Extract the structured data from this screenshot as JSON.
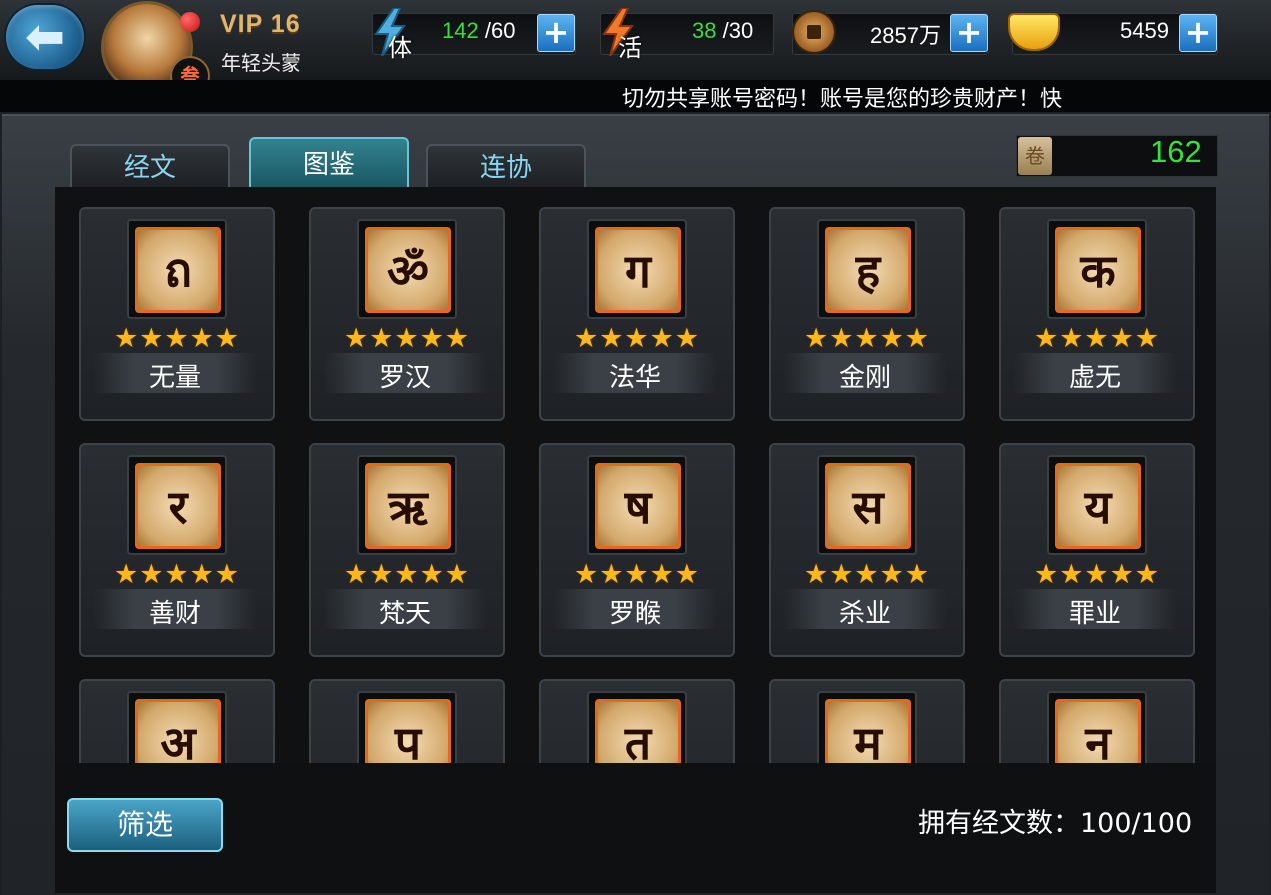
{
  "header": {
    "vip_label": "VIP 16",
    "player_title": "年轻头蒙",
    "rank_badge": "叁",
    "stamina": {
      "icon_label": "体",
      "current": "142",
      "max": "/60"
    },
    "vitality": {
      "icon_label": "活",
      "current": "38",
      "max": "/30"
    },
    "copper": {
      "value": "2857万"
    },
    "gold": {
      "value": "5459"
    },
    "plus_symbol": "+"
  },
  "ticker": {
    "text": "切勿共享账号密码！账号是您的珍贵财产！快"
  },
  "tabs": [
    {
      "label": "经文",
      "active": false
    },
    {
      "label": "图鉴",
      "active": true
    },
    {
      "label": "连协",
      "active": false
    }
  ],
  "counter": {
    "value": "162",
    "icon": "scroll-icon"
  },
  "stars": "★★★★★",
  "cards": [
    {
      "name": "无量",
      "glyph": "ถ"
    },
    {
      "name": "罗汉",
      "glyph": "ॐ"
    },
    {
      "name": "法华",
      "glyph": "ग"
    },
    {
      "name": "金刚",
      "glyph": "ह"
    },
    {
      "name": "虚无",
      "glyph": "क"
    },
    {
      "name": "善财",
      "glyph": "र"
    },
    {
      "name": "梵天",
      "glyph": "ऋ"
    },
    {
      "name": "罗睺",
      "glyph": "ष"
    },
    {
      "name": "杀业",
      "glyph": "स"
    },
    {
      "name": "罪业",
      "glyph": "य"
    },
    {
      "name": "",
      "glyph": "अ"
    },
    {
      "name": "",
      "glyph": "प"
    },
    {
      "name": "",
      "glyph": "त"
    },
    {
      "name": "",
      "glyph": "म"
    },
    {
      "name": "",
      "glyph": "न"
    }
  ],
  "footer": {
    "filter_label": "筛选",
    "owned_text": "拥有经文数：100/100"
  },
  "colors": {
    "accent": "#35e23b",
    "tab_active": "#33828f",
    "star": "#ffb71a"
  }
}
